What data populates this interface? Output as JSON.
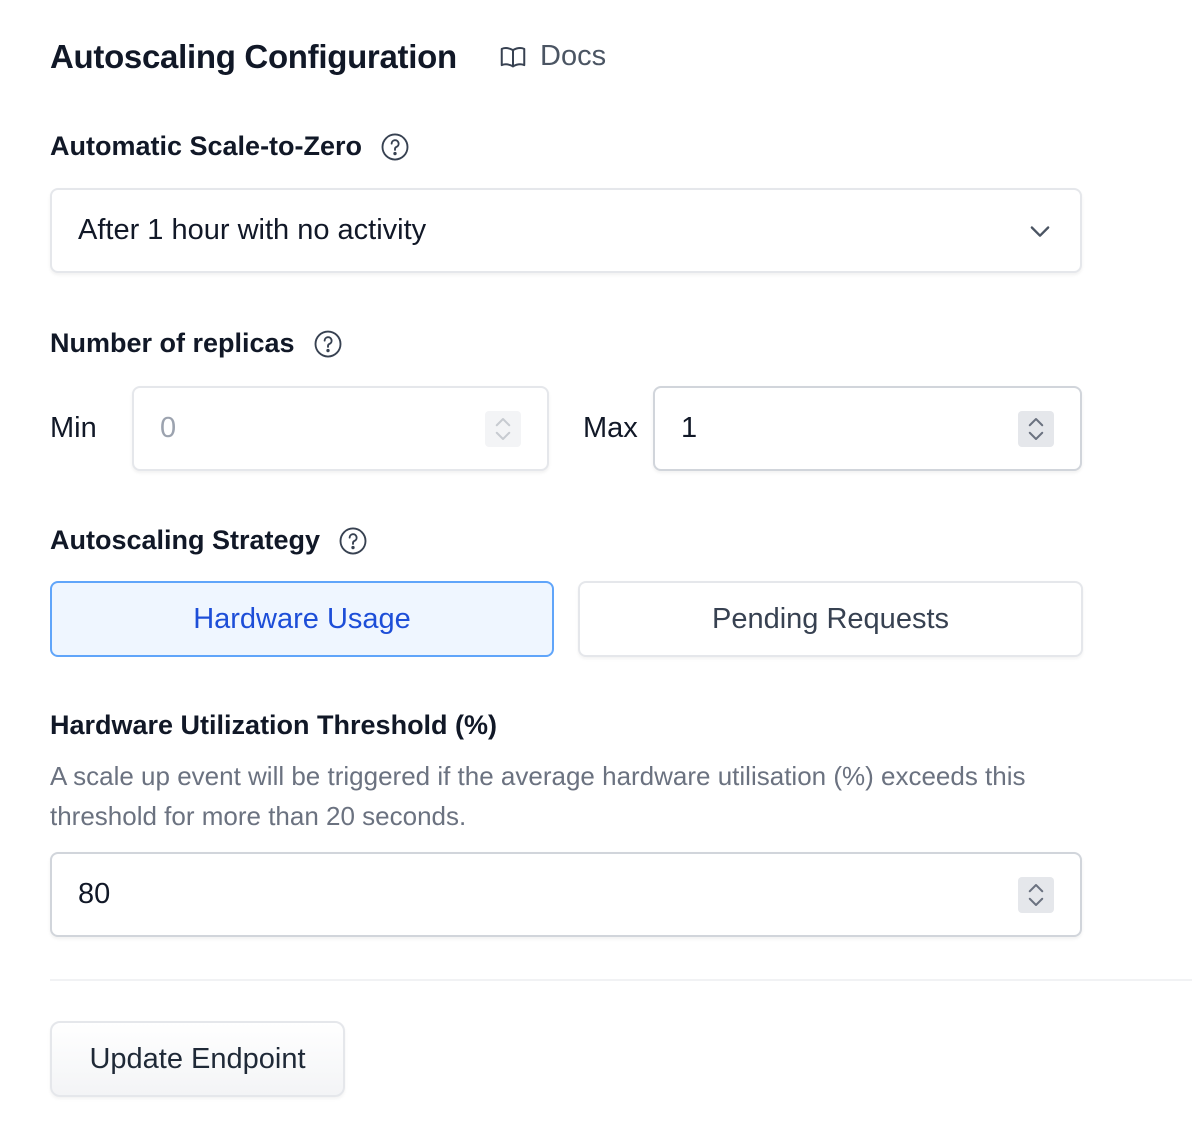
{
  "header": {
    "title": "Autoscaling Configuration",
    "docs_label": "Docs"
  },
  "scale_to_zero": {
    "label": "Automatic Scale-to-Zero",
    "selected": "After 1 hour with no activity"
  },
  "replicas": {
    "label": "Number of replicas",
    "min_label": "Min",
    "min_value": "0",
    "max_label": "Max",
    "max_value": "1"
  },
  "strategy": {
    "label": "Autoscaling Strategy",
    "options": [
      "Hardware Usage",
      "Pending Requests"
    ],
    "selected_index": 0
  },
  "threshold": {
    "label": "Hardware Utilization Threshold (%)",
    "description": "A scale up event will be triggered if the average hardware utilisation (%) exceeds this threshold for more than 20 seconds.",
    "value": "80"
  },
  "actions": {
    "update_label": "Update Endpoint"
  },
  "colors": {
    "accent": "#1d4ed8",
    "accent_bg": "#eff6ff",
    "accent_border": "#60a5fa",
    "muted_text": "#6b7280"
  },
  "icons": {
    "docs": "book-open-icon",
    "help": "question-circle-icon",
    "dropdown": "chevron-down-icon",
    "stepper": "up-down-chevron-icon"
  }
}
